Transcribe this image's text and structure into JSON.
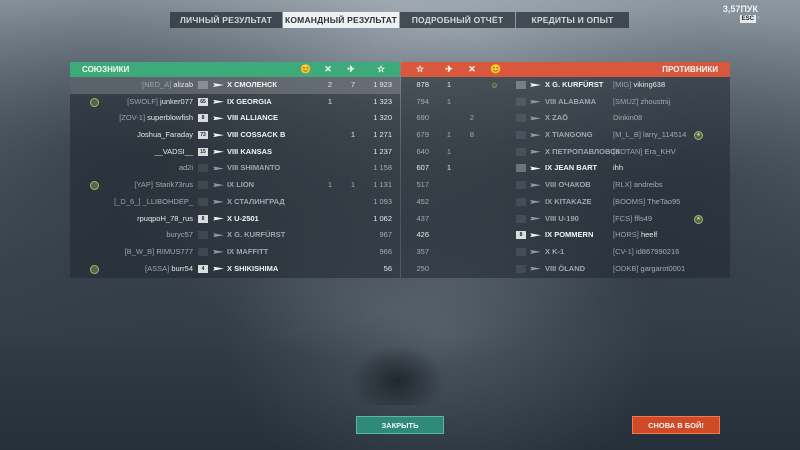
{
  "tabs": [
    {
      "label": "ЛИЧНЫЙ РЕЗУЛЬТАТ",
      "active": false
    },
    {
      "label": "КОМАНДНЫЙ РЕЗУЛЬТАТ",
      "active": true
    },
    {
      "label": "ПОДРОБНЫЙ ОТЧЁТ",
      "active": false
    },
    {
      "label": "КРЕДИТЫ И ОПЫТ",
      "active": false
    }
  ],
  "top_right": {
    "credits": "3,57ПУК",
    "esc_label": "ESC",
    "close_glyph": "×"
  },
  "allies": {
    "title": "СОЮЗНИКИ",
    "header_icons": [
      "😊",
      "✕",
      "✈",
      "☆"
    ],
    "color": "#3daa79",
    "rows": [
      {
        "clan": "[NED_A]",
        "player": "alizab",
        "tier_badge": "",
        "tier": "X",
        "ship": "СМОЛЕНСК",
        "crown": true,
        "c1": "2",
        "c2": "7",
        "score": "1 923",
        "medal": false,
        "me": true,
        "dim": false
      },
      {
        "clan": "[SWOLF]",
        "player": "junker077",
        "tier_badge": "65",
        "tier": "IX",
        "ship": "GEORGIA",
        "crown": false,
        "c1": "1",
        "c2": "",
        "score": "1 323",
        "medal": true,
        "me": false,
        "dim": false
      },
      {
        "clan": "[ZOV-1]",
        "player": "superblowfish",
        "tier_badge": "8",
        "tier": "VIII",
        "ship": "ALLIANCE",
        "crown": false,
        "c1": "",
        "c2": "",
        "score": "1 320",
        "medal": false,
        "me": false,
        "dim": false
      },
      {
        "clan": "",
        "player": "Joshua_Faraday",
        "tier_badge": "73",
        "tier": "VIII",
        "ship": "COSSACK B",
        "crown": false,
        "c1": "",
        "c2": "1",
        "score": "1 271",
        "medal": false,
        "me": false,
        "dim": false
      },
      {
        "clan": "",
        "player": "__VADSI__",
        "tier_badge": "15",
        "tier": "VIII",
        "ship": "KANSAS",
        "crown": false,
        "c1": "",
        "c2": "",
        "score": "1 237",
        "medal": false,
        "me": false,
        "dim": false
      },
      {
        "clan": "",
        "player": "ad2i",
        "tier_badge": "",
        "tier": "VIII",
        "ship": "SHIMANTO",
        "crown": false,
        "c1": "",
        "c2": "",
        "score": "1 158",
        "medal": false,
        "me": false,
        "dim": true
      },
      {
        "clan": "[YAP]",
        "player": "Starik73rus",
        "tier_badge": "",
        "tier": "IX",
        "ship": "LION",
        "crown": false,
        "c1": "1",
        "c2": "1",
        "score": "1 131",
        "medal": true,
        "me": false,
        "dim": true
      },
      {
        "clan": "[_D_6_]",
        "player": "_LLIBOHDEP_",
        "tier_badge": "",
        "tier": "X",
        "ship": "СТАЛИНГРАД",
        "crown": false,
        "c1": "",
        "c2": "",
        "score": "1 093",
        "medal": false,
        "me": false,
        "dim": true
      },
      {
        "clan": "",
        "player": "rpuqpoH_78_rus",
        "tier_badge": "8",
        "tier": "X",
        "ship": "U-2501",
        "crown": false,
        "c1": "",
        "c2": "",
        "score": "1 062",
        "medal": false,
        "me": false,
        "dim": false
      },
      {
        "clan": "",
        "player": "buryc57",
        "tier_badge": "",
        "tier": "X",
        "ship": "G. KURFÜRST",
        "crown": false,
        "c1": "",
        "c2": "",
        "score": "967",
        "medal": false,
        "me": false,
        "dim": true
      },
      {
        "clan": "[B_W_B]",
        "player": "RIMUS777",
        "tier_badge": "",
        "tier": "IX",
        "ship": "MAFFITT",
        "crown": false,
        "c1": "",
        "c2": "",
        "score": "966",
        "medal": false,
        "me": false,
        "dim": true
      },
      {
        "clan": "[ASSA]",
        "player": "burr54",
        "tier_badge": "4",
        "tier": "X",
        "ship": "SHIKISHIMA",
        "crown": false,
        "c1": "",
        "c2": "",
        "score": "56",
        "medal": true,
        "me": false,
        "dim": false
      }
    ]
  },
  "enemies": {
    "title": "ПРОТИВНИКИ",
    "header_icons": [
      "☆",
      "✈",
      "✕",
      "😊"
    ],
    "color": "#d9573c",
    "rows": [
      {
        "score": "878",
        "c2": "1",
        "c1": "",
        "crown": true,
        "tier_badge": "",
        "tier": "X",
        "ship": "G. KURFÜRST",
        "clan": "[MIG]",
        "player": "viking638",
        "medal": false,
        "dim": false
      },
      {
        "score": "794",
        "c2": "1",
        "c1": "",
        "crown": false,
        "tier_badge": "",
        "tier": "VIII",
        "ship": "ALABAMA",
        "clan": "[SMUZ]",
        "player": "zhoustnij",
        "medal": false,
        "dim": true
      },
      {
        "score": "690",
        "c2": "",
        "c1": "2",
        "crown": false,
        "tier_badge": "",
        "tier": "X",
        "ship": "ZAŌ",
        "clan": "",
        "player": "Dinkin08",
        "medal": false,
        "dim": true
      },
      {
        "score": "679",
        "c2": "1",
        "c1": "8",
        "crown": false,
        "tier_badge": "",
        "tier": "X",
        "ship": "TIANGONG",
        "clan": "[M_L_B]",
        "player": "larry_114514",
        "medal": true,
        "dim": true
      },
      {
        "score": "640",
        "c2": "1",
        "c1": "",
        "crown": false,
        "tier_badge": "",
        "tier": "X",
        "ship": "ПЕТРОПАВЛОВСК",
        "clan": "[BOTAN]",
        "player": "Era_KHV",
        "medal": false,
        "dim": true
      },
      {
        "score": "607",
        "c2": "1",
        "c1": "",
        "crown": false,
        "tier_badge": "",
        "tier": "IX",
        "ship": "JEAN BART",
        "clan": "",
        "player": "ihh",
        "medal": false,
        "dim": false
      },
      {
        "score": "517",
        "c2": "",
        "c1": "",
        "crown": false,
        "tier_badge": "",
        "tier": "VIII",
        "ship": "ОЧАКОВ",
        "clan": "[RLX]",
        "player": "andreibs",
        "medal": false,
        "dim": true
      },
      {
        "score": "452",
        "c2": "",
        "c1": "",
        "crown": false,
        "tier_badge": "",
        "tier": "IX",
        "ship": "KITAKAZE",
        "clan": "[BOOMS]",
        "player": "TheTao95",
        "medal": false,
        "dim": true
      },
      {
        "score": "437",
        "c2": "",
        "c1": "",
        "crown": false,
        "tier_badge": "",
        "tier": "VIII",
        "ship": "U-190",
        "clan": "[FCS]",
        "player": "ffls49",
        "medal": true,
        "dim": true
      },
      {
        "score": "426",
        "c2": "",
        "c1": "",
        "crown": false,
        "tier_badge": "8",
        "tier": "IX",
        "ship": "POMMERN",
        "clan": "[HORS]",
        "player": "heelf",
        "medal": false,
        "dim": false
      },
      {
        "score": "357",
        "c2": "",
        "c1": "",
        "crown": false,
        "tier_badge": "",
        "tier": "X",
        "ship": "K-1",
        "clan": "[CV-1]",
        "player": "id867990216",
        "medal": false,
        "dim": true
      },
      {
        "score": "250",
        "c2": "",
        "c1": "",
        "crown": false,
        "tier_badge": "",
        "tier": "VIII",
        "ship": "ÖLAND",
        "clan": "[ODKB]",
        "player": "gargarot0001",
        "medal": false,
        "dim": true
      }
    ]
  },
  "buttons": {
    "close": "ЗАКРЫТЬ",
    "again": "СНОВА В БОЙ!"
  }
}
